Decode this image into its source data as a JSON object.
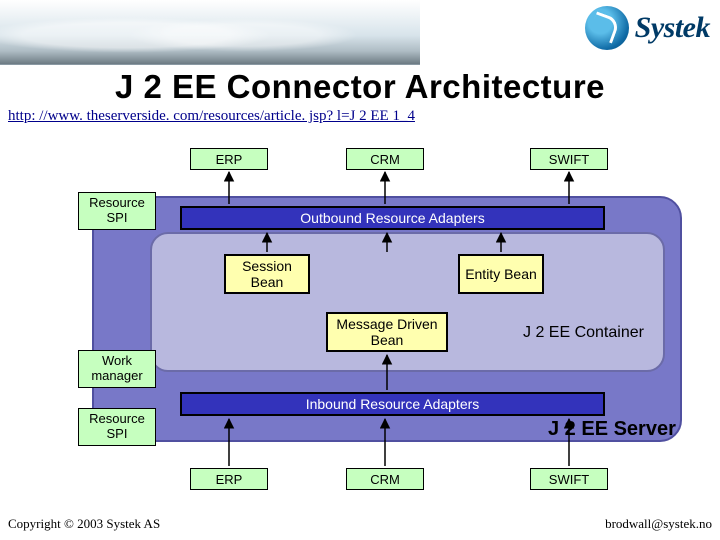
{
  "logo": "Systek",
  "title": "J 2 EE Connector Architecture",
  "url": "http: //www. theserverside. com/resources/article. jsp? l=J 2 EE 1_4",
  "ext_top": {
    "erp": "ERP",
    "crm": "CRM",
    "swift": "SWIFT"
  },
  "side": {
    "resource_spi_top": "Resource SPI",
    "work_manager": "Work manager",
    "resource_spi_bottom": "Resource SPI"
  },
  "bars": {
    "outbound": "Outbound Resource Adapters",
    "inbound": "Inbound Resource Adapters"
  },
  "beans": {
    "session": "Session Bean",
    "mdb": "Message Driven Bean",
    "entity": "Entity Bean"
  },
  "labels": {
    "container": "J 2 EE Container",
    "server": "J 2 EE Server"
  },
  "ext_bottom": {
    "erp": "ERP",
    "crm": "CRM",
    "swift": "SWIFT"
  },
  "footer": {
    "copyright": "Copyright © 2003 Systek AS",
    "email": "brodwall@systek.no"
  }
}
